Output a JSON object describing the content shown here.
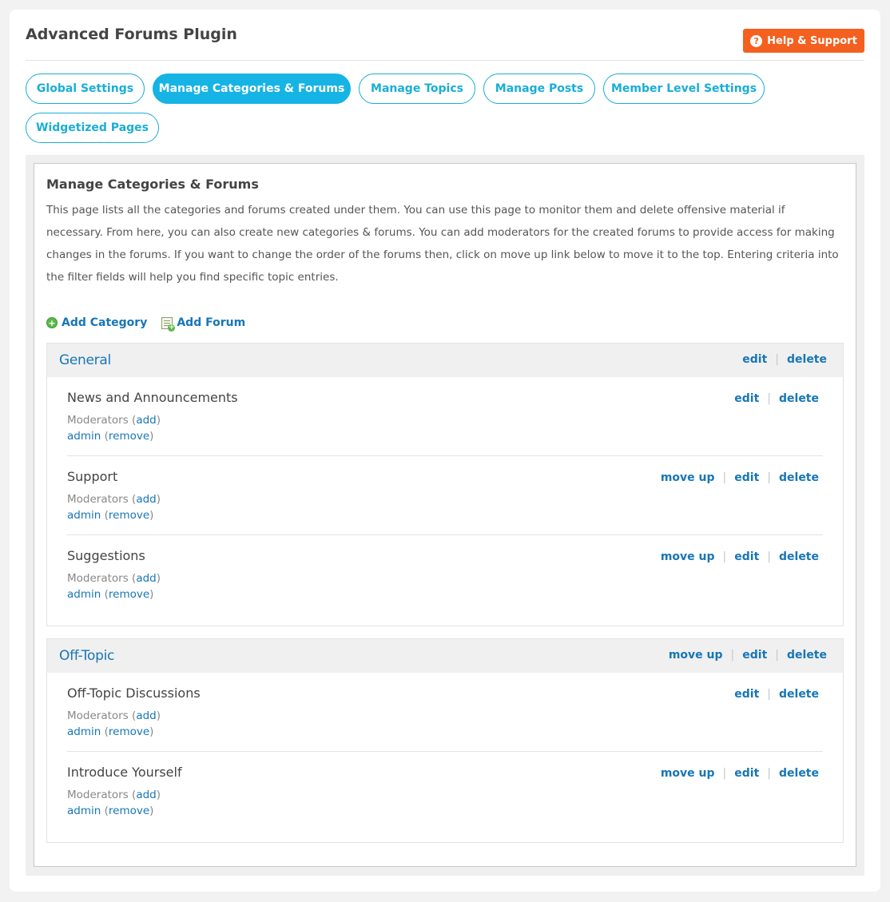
{
  "header": {
    "title": "Advanced Forums Plugin",
    "help_label": "Help & Support",
    "help_icon": "?"
  },
  "tabs": [
    {
      "label": "Global Settings",
      "active": false
    },
    {
      "label": "Manage Categories & Forums",
      "active": true
    },
    {
      "label": "Manage Topics",
      "active": false
    },
    {
      "label": "Manage Posts",
      "active": false
    },
    {
      "label": "Member Level Settings",
      "active": false
    },
    {
      "label": "Widgetized Pages",
      "active": false
    }
  ],
  "panel": {
    "title": "Manage Categories & Forums",
    "description": "This page lists all the categories and forums created under them. You can use this page to monitor them and delete offensive material if necessary. From here, you can also create new categories & forums. You can add moderators for the created forums to provide access for making changes in the forums. If you want to change the order of the forums then, click on move up link below to move it to the top. Entering criteria into the filter fields will help you find specific topic entries.",
    "add_category": "Add Category",
    "add_forum": "Add Forum"
  },
  "labels": {
    "edit": "edit",
    "delete": "delete",
    "move_up": "move up",
    "separator": "|",
    "moderators": "Moderators",
    "add": "add",
    "remove": "remove",
    "paren_open": "(",
    "paren_close": ")"
  },
  "categories": [
    {
      "name": "General",
      "forums": [
        {
          "name": "News and Announcements",
          "moderator": "admin"
        },
        {
          "name": "Support",
          "moderator": "admin"
        },
        {
          "name": "Suggestions",
          "moderator": "admin"
        }
      ]
    },
    {
      "name": "Off-Topic",
      "forums": [
        {
          "name": "Off-Topic Discussions",
          "moderator": "admin"
        },
        {
          "name": "Introduce Yourself",
          "moderator": "admin"
        }
      ]
    }
  ],
  "colors": {
    "accent": "#16b4e4",
    "link": "#1776b8",
    "help_button": "#f4601f"
  }
}
